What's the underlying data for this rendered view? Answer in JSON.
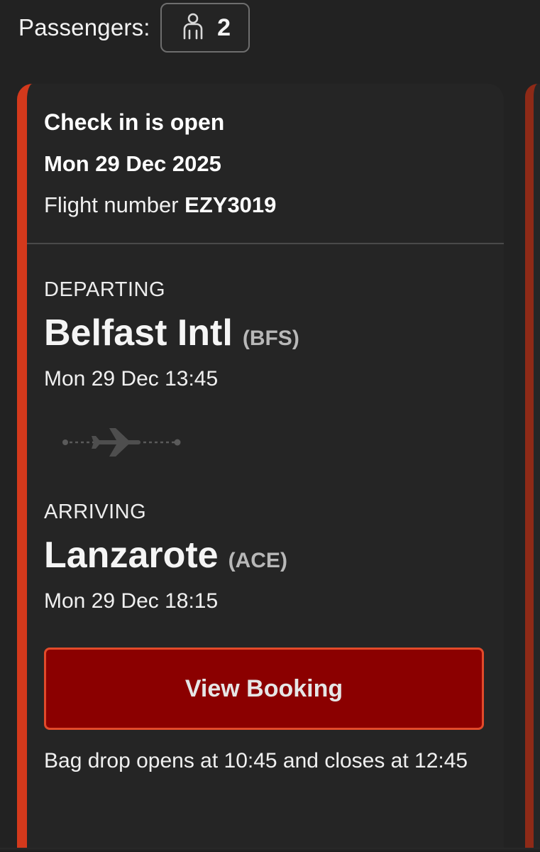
{
  "passengers": {
    "label": "Passengers:",
    "count": "2",
    "icon": "passenger-icon"
  },
  "flight": {
    "checkin_status": "Check in is open",
    "date": "Mon 29 Dec 2025",
    "flight_number_label": "Flight number",
    "flight_number": "EZY3019",
    "departing": {
      "label": "DEPARTING",
      "airport": "Belfast Intl",
      "code": "(BFS)",
      "time": "Mon 29 Dec 13:45"
    },
    "route_icon": "plane-icon",
    "arriving": {
      "label": "ARRIVING",
      "airport": "Lanzarote",
      "code": "(ACE)",
      "time": "Mon 29 Dec 18:15"
    },
    "view_booking_label": "View Booking",
    "bag_drop_text": "Bag drop opens at 10:45 and closes at 12:45"
  },
  "colors": {
    "background": "#222222",
    "card_accent": "#d3391c",
    "button_fill": "#8b0000",
    "button_border": "#e24a2a"
  }
}
